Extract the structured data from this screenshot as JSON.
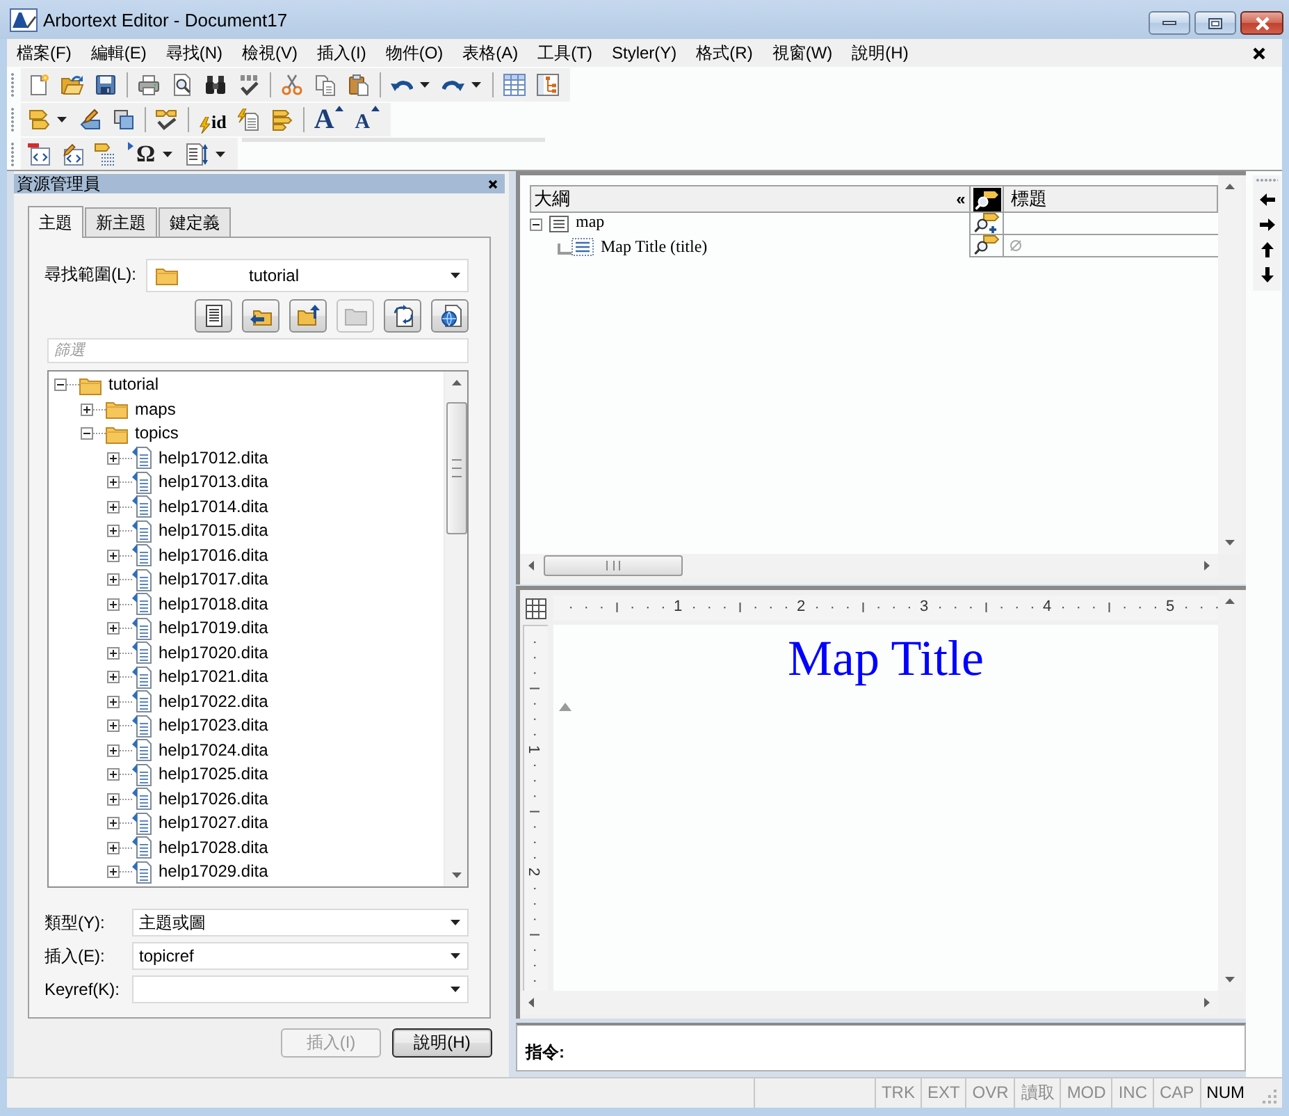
{
  "window": {
    "title": "Arbortext Editor - Document17"
  },
  "menu": {
    "items": [
      "檔案(F)",
      "編輯(E)",
      "尋找(N)",
      "檢視(V)",
      "插入(I)",
      "物件(O)",
      "表格(A)",
      "工具(T)",
      "Styler(Y)",
      "格式(R)",
      "視窗(W)",
      "說明(H)"
    ]
  },
  "toolbar_glyphs": {
    "id": "id",
    "grow_font": "A",
    "shrink_font": "A",
    "symbol": "Ω"
  },
  "resource_manager": {
    "title": "資源管理員",
    "tabs": [
      {
        "label": "主題",
        "selected": true
      },
      {
        "label": "新主題",
        "selected": false
      },
      {
        "label": "鍵定義",
        "selected": false
      }
    ],
    "look_in": {
      "label": "尋找範圍(L):",
      "value": "tutorial"
    },
    "action_buttons": [
      {
        "disabled": false
      },
      {
        "disabled": false
      },
      {
        "disabled": false
      },
      {
        "disabled": true
      },
      {
        "disabled": false
      },
      {
        "disabled": false
      }
    ],
    "filter": {
      "placeholder": "篩選"
    },
    "tree": [
      {
        "label": "tutorial",
        "kind": "folder",
        "expanded": true,
        "children": [
          {
            "label": "maps",
            "kind": "folder",
            "expanded": false
          },
          {
            "label": "topics",
            "kind": "folder",
            "expanded": true,
            "children": [
              {
                "label": "help17012.dita",
                "kind": "file",
                "expanded": false
              },
              {
                "label": "help17013.dita",
                "kind": "file",
                "expanded": false
              },
              {
                "label": "help17014.dita",
                "kind": "file",
                "expanded": false
              },
              {
                "label": "help17015.dita",
                "kind": "file",
                "expanded": false
              },
              {
                "label": "help17016.dita",
                "kind": "file",
                "expanded": false
              },
              {
                "label": "help17017.dita",
                "kind": "file",
                "expanded": false
              },
              {
                "label": "help17018.dita",
                "kind": "file",
                "expanded": false
              },
              {
                "label": "help17019.dita",
                "kind": "file",
                "expanded": false
              },
              {
                "label": "help17020.dita",
                "kind": "file",
                "expanded": false
              },
              {
                "label": "help17021.dita",
                "kind": "file",
                "expanded": false
              },
              {
                "label": "help17022.dita",
                "kind": "file",
                "expanded": false
              },
              {
                "label": "help17023.dita",
                "kind": "file",
                "expanded": false
              },
              {
                "label": "help17024.dita",
                "kind": "file",
                "expanded": false
              },
              {
                "label": "help17025.dita",
                "kind": "file",
                "expanded": false
              },
              {
                "label": "help17026.dita",
                "kind": "file",
                "expanded": false
              },
              {
                "label": "help17027.dita",
                "kind": "file",
                "expanded": false
              },
              {
                "label": "help17028.dita",
                "kind": "file",
                "expanded": false
              },
              {
                "label": "help17029.dita",
                "kind": "file",
                "expanded": false
              }
            ]
          }
        ]
      }
    ],
    "fields": [
      {
        "label": "類型(Y):",
        "value": "主題或圖"
      },
      {
        "label": "插入(E):",
        "value": "topicref"
      },
      {
        "label": "Keyref(K):"
      }
    ],
    "buttons": [
      {
        "label": "插入(I)",
        "disabled": true,
        "default": false
      },
      {
        "label": "說明(H)",
        "disabled": false,
        "default": true
      }
    ]
  },
  "outline": {
    "columns": {
      "outline": "大綱",
      "collapse": "«",
      "title": "標題"
    },
    "rows": [
      {
        "label": "map",
        "kind": "container",
        "expanded": true,
        "children": [
          {
            "label": "Map Title (title)",
            "kind": "element",
            "title_null": true
          }
        ]
      }
    ]
  },
  "editor": {
    "ruler": {
      "horizontal": [
        "1",
        "2",
        "3",
        "4",
        "5"
      ],
      "vertical": [
        "1",
        "2"
      ]
    },
    "title": "Map Title"
  },
  "command_line": {
    "label": "指令:"
  },
  "status_bar": {
    "indicators": [
      {
        "label": "TRK",
        "on": false
      },
      {
        "label": "EXT",
        "on": false
      },
      {
        "label": "OVR",
        "on": false
      },
      {
        "label": "讀取",
        "on": false
      },
      {
        "label": "MOD",
        "on": false
      },
      {
        "label": "INC",
        "on": false
      },
      {
        "label": "CAP",
        "on": false
      },
      {
        "label": "NUM",
        "on": true
      }
    ]
  }
}
